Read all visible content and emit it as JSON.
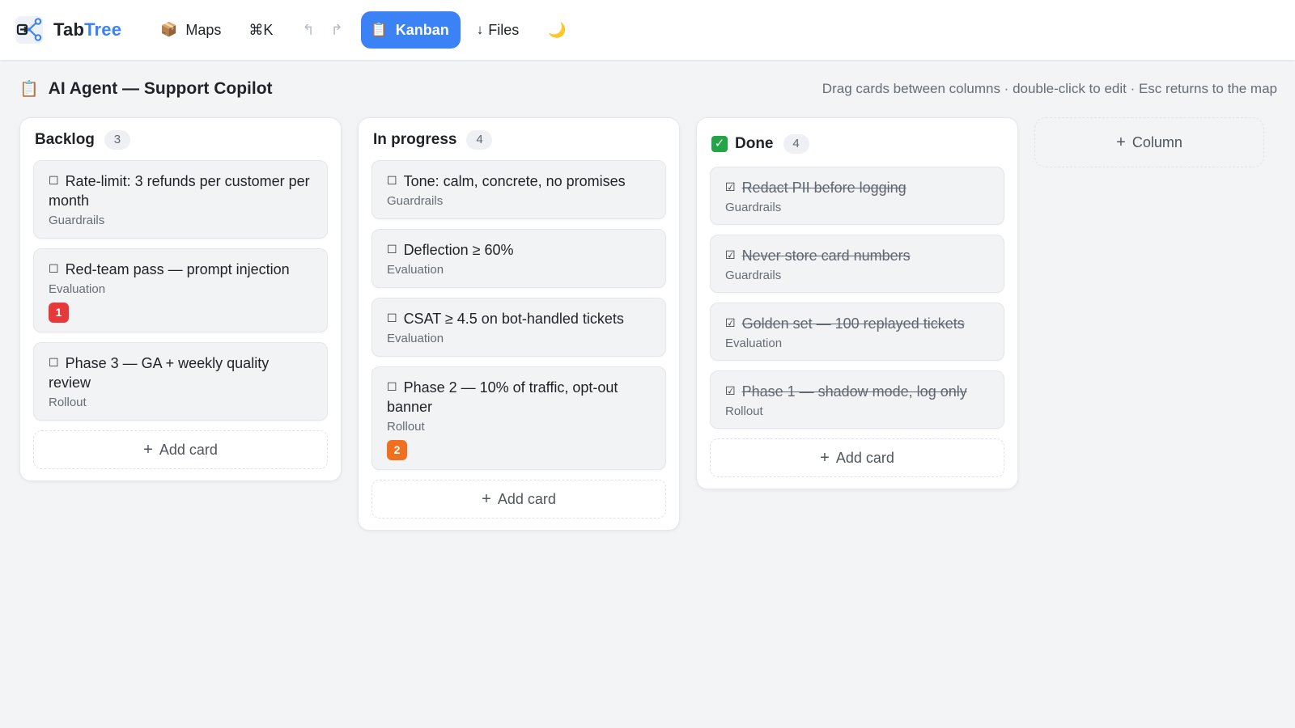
{
  "app": {
    "name_prefix": "Tab",
    "name_accent": "Tree",
    "accent_color": "#3b82f6",
    "logo_icon": "tree-share-icon"
  },
  "nav": {
    "maps": {
      "icon": "box-icon",
      "glyph": "📦",
      "label": "Maps"
    },
    "command": {
      "label": "⌘K"
    },
    "undo": {
      "icon": "undo-icon",
      "glyph": "↰"
    },
    "redo": {
      "icon": "redo-icon",
      "glyph": "↱"
    },
    "kanban": {
      "icon": "clipboard-icon",
      "glyph": "📋",
      "label": "Kanban",
      "active": true
    },
    "files": {
      "icon": "download-arrow-icon",
      "glyph": "↓",
      "label": "Files"
    },
    "theme": {
      "icon": "moon-icon",
      "glyph": "🌙"
    }
  },
  "page": {
    "icon": "clipboard-icon",
    "glyph": "📋",
    "title": "AI Agent — Support Copilot",
    "hint": "Drag cards between columns · double-click to edit · Esc returns to the map"
  },
  "columns": {
    "backlog": {
      "title": "Backlog",
      "count": "3",
      "cards": [
        {
          "title": "Rate-limit: 3 refunds per customer per month",
          "tag": "Guardrails"
        },
        {
          "title": "Red-team pass — prompt injection",
          "tag": "Evaluation",
          "badge": "1"
        },
        {
          "title": "Phase 3 — GA + weekly quality review",
          "tag": "Rollout"
        }
      ],
      "add_label": "Add card"
    },
    "progress": {
      "title": "In progress",
      "count": "4",
      "cards": [
        {
          "title": "Tone: calm, concrete, no promises",
          "tag": "Guardrails"
        },
        {
          "title": "Deflection ≥ 60%",
          "tag": "Evaluation"
        },
        {
          "title": "CSAT ≥ 4.5 on bot-handled tickets",
          "tag": "Evaluation"
        },
        {
          "title": "Phase 2 — 10% of traffic, opt-out banner",
          "tag": "Rollout",
          "badge": "2"
        }
      ],
      "add_label": "Add card"
    },
    "done": {
      "check_glyph": "✓",
      "check_color": "#22a447",
      "title": "Done",
      "count": "4",
      "cards": [
        {
          "title": "Redact PII before logging",
          "tag": "Guardrails"
        },
        {
          "title": "Never store card numbers",
          "tag": "Guardrails"
        },
        {
          "title": "Golden set — 100 replayed tickets",
          "tag": "Evaluation"
        },
        {
          "title": "Phase 1 — shadow mode, log only",
          "tag": "Rollout"
        }
      ],
      "add_label": "Add card"
    }
  },
  "checkbox": {
    "unchecked": "☐",
    "checked": "☑"
  },
  "add_column_label": "Column",
  "plus_glyph": "+",
  "colors": {
    "badge_red": "#e5393a",
    "badge_orange": "#f0701f",
    "background": "#f3f4f6"
  }
}
